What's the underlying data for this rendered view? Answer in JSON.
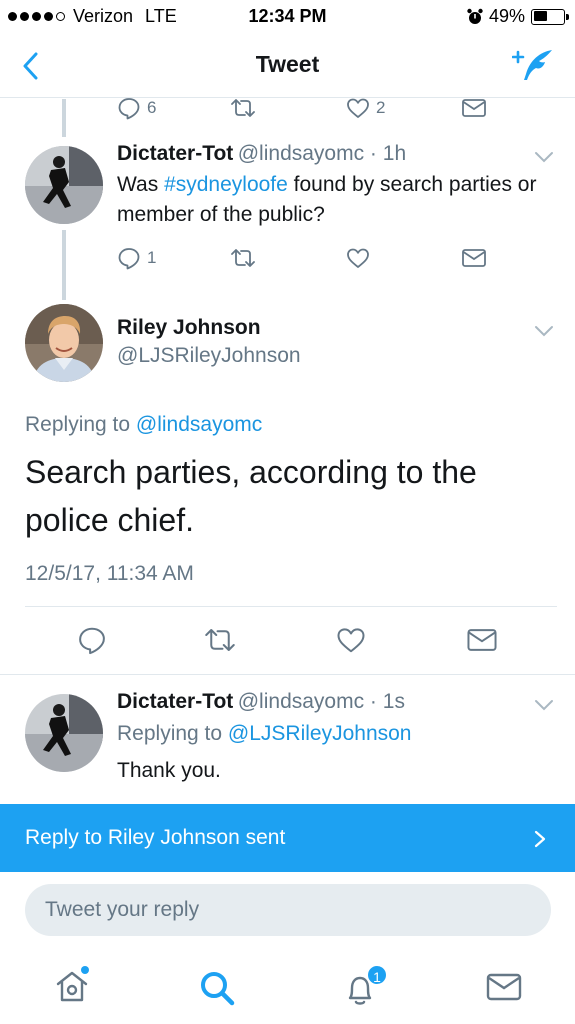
{
  "status_bar": {
    "carrier": "Verizon",
    "network": "LTE",
    "time": "12:34 PM",
    "battery": "49%",
    "battery_level": 0.49
  },
  "header": {
    "title": "Tweet"
  },
  "prev_tweet_actions": {
    "replies": "6",
    "likes": "2"
  },
  "tweet1": {
    "name": "Dictater-Tot",
    "handle": "@lindsayomc",
    "time": "1h",
    "text_prefix": "Was ",
    "hashtag": "#sydneyloofe",
    "text_suffix": " found by search parties or member of the public?",
    "replies": "1"
  },
  "main_tweet": {
    "name": "Riley Johnson",
    "handle": "@LJSRileyJohnson",
    "replying_label": "Replying to",
    "replying_handle": "@lindsayomc",
    "text": "Search parties, according to the police chief.",
    "timestamp": "12/5/17, 11:34 AM"
  },
  "reply_tweet": {
    "name": "Dictater-Tot",
    "handle": "@lindsayomc",
    "time": "1s",
    "replying_label": "Replying to",
    "replying_handle": "@LJSRileyJohnson",
    "text": "Thank you."
  },
  "banner": {
    "text": "Reply to Riley Johnson sent"
  },
  "composer": {
    "placeholder": "Tweet your reply"
  },
  "tabbar": {
    "notifications_count": "1"
  },
  "colors": {
    "accent": "#1da1f2",
    "link": "#1b95e0",
    "muted": "#657786"
  }
}
